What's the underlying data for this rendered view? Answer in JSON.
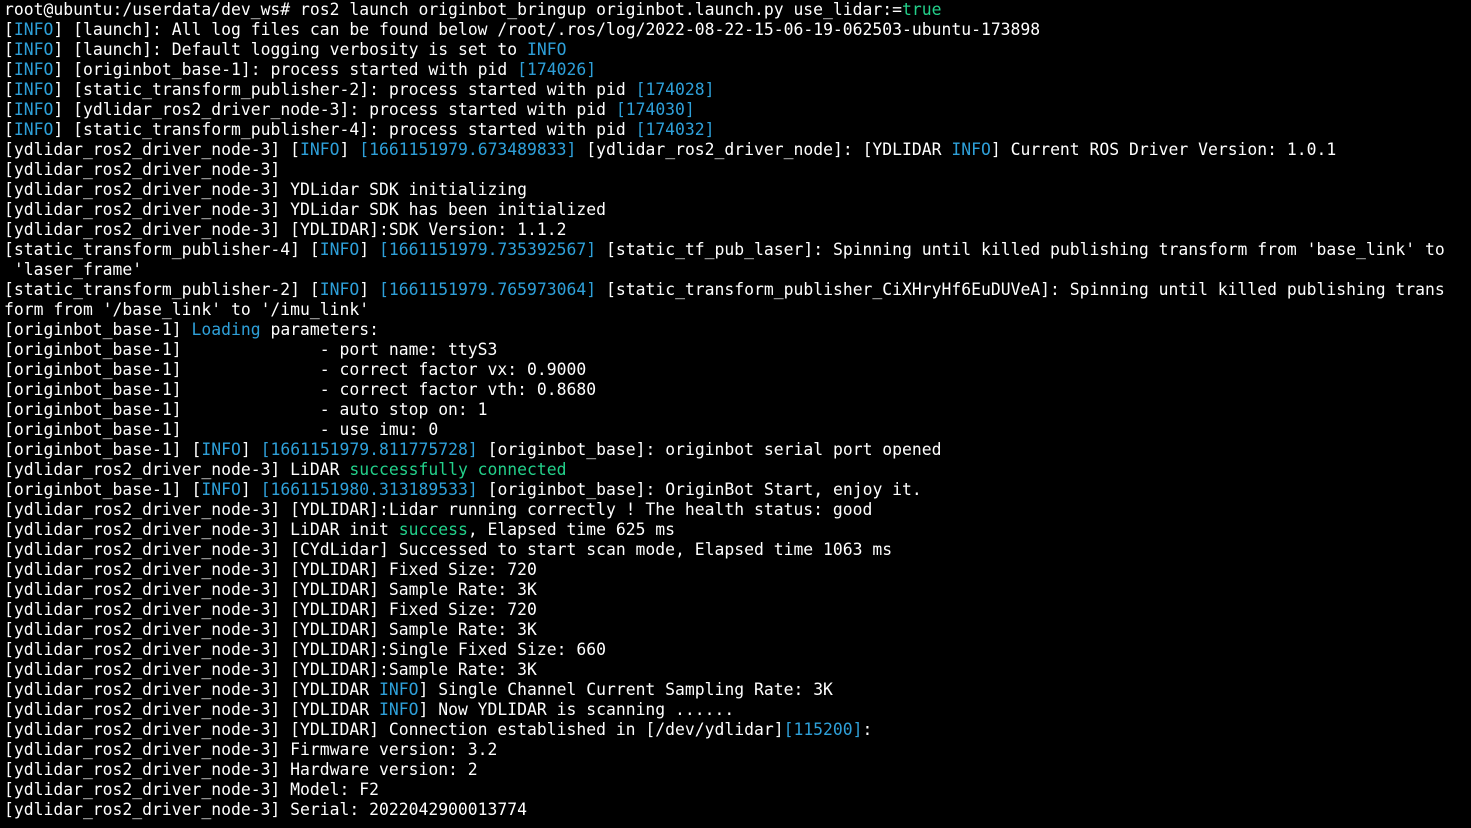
{
  "colors": {
    "background": "#000000",
    "text": "#ffffff",
    "info": "#2ea0d9",
    "green": "#23d18b"
  },
  "terminal": {
    "lines": [
      [
        {
          "t": "root@ubuntu:/userdata/dev_ws# ros2 launch originbot_bringup originbot.launch.py use_lidar:=",
          "c": "default"
        },
        {
          "t": "true",
          "c": "green"
        }
      ],
      [
        {
          "t": "[",
          "c": "default"
        },
        {
          "t": "INFO",
          "c": "info"
        },
        {
          "t": "] [launch]: All log files can be found below /root/.ros/log/2022-08-22-15-06-19-062503-ubuntu-173898",
          "c": "default"
        }
      ],
      [
        {
          "t": "[",
          "c": "default"
        },
        {
          "t": "INFO",
          "c": "info"
        },
        {
          "t": "] [launch]: Default logging verbosity is set to ",
          "c": "default"
        },
        {
          "t": "INFO",
          "c": "info"
        }
      ],
      [
        {
          "t": "[",
          "c": "default"
        },
        {
          "t": "INFO",
          "c": "info"
        },
        {
          "t": "] [originbot_base-1]: process started with pid ",
          "c": "default"
        },
        {
          "t": "[174026]",
          "c": "num"
        }
      ],
      [
        {
          "t": "[",
          "c": "default"
        },
        {
          "t": "INFO",
          "c": "info"
        },
        {
          "t": "] [static_transform_publisher-2]: process started with pid ",
          "c": "default"
        },
        {
          "t": "[174028]",
          "c": "num"
        }
      ],
      [
        {
          "t": "[",
          "c": "default"
        },
        {
          "t": "INFO",
          "c": "info"
        },
        {
          "t": "] [ydlidar_ros2_driver_node-3]: process started with pid ",
          "c": "default"
        },
        {
          "t": "[174030]",
          "c": "num"
        }
      ],
      [
        {
          "t": "[",
          "c": "default"
        },
        {
          "t": "INFO",
          "c": "info"
        },
        {
          "t": "] [static_transform_publisher-4]: process started with pid ",
          "c": "default"
        },
        {
          "t": "[174032]",
          "c": "num"
        }
      ],
      [
        {
          "t": "[ydlidar_ros2_driver_node-3] [",
          "c": "default"
        },
        {
          "t": "INFO",
          "c": "info"
        },
        {
          "t": "] ",
          "c": "default"
        },
        {
          "t": "[1661151979.673489833]",
          "c": "num"
        },
        {
          "t": " [ydlidar_ros2_driver_node]: [YDLIDAR ",
          "c": "default"
        },
        {
          "t": "INFO",
          "c": "info"
        },
        {
          "t": "] Current ROS Driver Version: 1.0.1",
          "c": "default"
        }
      ],
      [
        {
          "t": "[ydlidar_ros2_driver_node-3]",
          "c": "default"
        }
      ],
      [
        {
          "t": "[ydlidar_ros2_driver_node-3] YDLidar SDK initializing",
          "c": "default"
        }
      ],
      [
        {
          "t": "[ydlidar_ros2_driver_node-3] YDLidar SDK has been initialized",
          "c": "default"
        }
      ],
      [
        {
          "t": "[ydlidar_ros2_driver_node-3] [YDLIDAR]:SDK Version: 1.1.2",
          "c": "default"
        }
      ],
      [
        {
          "t": "[static_transform_publisher-4] [",
          "c": "default"
        },
        {
          "t": "INFO",
          "c": "info"
        },
        {
          "t": "] ",
          "c": "default"
        },
        {
          "t": "[1661151979.735392567]",
          "c": "num"
        },
        {
          "t": " [static_tf_pub_laser]: Spinning until killed publishing transform from 'base_link' to",
          "c": "default"
        }
      ],
      [
        {
          "t": " 'laser_frame'",
          "c": "default"
        }
      ],
      [
        {
          "t": "[static_transform_publisher-2] [",
          "c": "default"
        },
        {
          "t": "INFO",
          "c": "info"
        },
        {
          "t": "] ",
          "c": "default"
        },
        {
          "t": "[1661151979.765973064]",
          "c": "num"
        },
        {
          "t": " [static_transform_publisher_CiXHryHf6EuDUVeA]: Spinning until killed publishing trans",
          "c": "default"
        }
      ],
      [
        {
          "t": "form from '/base_link' to '/imu_link'",
          "c": "default"
        }
      ],
      [
        {
          "t": "[originbot_base-1] ",
          "c": "default"
        },
        {
          "t": "Loading",
          "c": "blue"
        },
        {
          "t": " parameters:",
          "c": "default"
        }
      ],
      [
        {
          "t": "[originbot_base-1]              - port name: ttyS3",
          "c": "default"
        }
      ],
      [
        {
          "t": "[originbot_base-1]              - correct factor vx: 0.9000",
          "c": "default"
        }
      ],
      [
        {
          "t": "[originbot_base-1]              - correct factor vth: 0.8680",
          "c": "default"
        }
      ],
      [
        {
          "t": "[originbot_base-1]              - auto stop on: 1",
          "c": "default"
        }
      ],
      [
        {
          "t": "[originbot_base-1]              - use imu: 0",
          "c": "default"
        }
      ],
      [
        {
          "t": "[originbot_base-1] [",
          "c": "default"
        },
        {
          "t": "INFO",
          "c": "info"
        },
        {
          "t": "] ",
          "c": "default"
        },
        {
          "t": "[1661151979.811775728]",
          "c": "num"
        },
        {
          "t": " [originbot_base]: originbot serial port opened",
          "c": "default"
        }
      ],
      [
        {
          "t": "[ydlidar_ros2_driver_node-3] LiDAR ",
          "c": "default"
        },
        {
          "t": "successfully connected",
          "c": "green"
        }
      ],
      [
        {
          "t": "[originbot_base-1] [",
          "c": "default"
        },
        {
          "t": "INFO",
          "c": "info"
        },
        {
          "t": "] ",
          "c": "default"
        },
        {
          "t": "[1661151980.313189533]",
          "c": "num"
        },
        {
          "t": " [originbot_base]: OriginBot Start, enjoy it.",
          "c": "default"
        }
      ],
      [
        {
          "t": "[ydlidar_ros2_driver_node-3] [YDLIDAR]:Lidar running correctly ! The health status: good",
          "c": "default"
        }
      ],
      [
        {
          "t": "[ydlidar_ros2_driver_node-3] LiDAR init ",
          "c": "default"
        },
        {
          "t": "success",
          "c": "green"
        },
        {
          "t": ", Elapsed time 625 ms",
          "c": "default"
        }
      ],
      [
        {
          "t": "[ydlidar_ros2_driver_node-3] [CYdLidar] Successed to start scan mode, Elapsed time 1063 ms",
          "c": "default"
        }
      ],
      [
        {
          "t": "[ydlidar_ros2_driver_node-3] [YDLIDAR] Fixed Size: 720",
          "c": "default"
        }
      ],
      [
        {
          "t": "[ydlidar_ros2_driver_node-3] [YDLIDAR] Sample Rate: 3K",
          "c": "default"
        }
      ],
      [
        {
          "t": "[ydlidar_ros2_driver_node-3] [YDLIDAR] Fixed Size: 720",
          "c": "default"
        }
      ],
      [
        {
          "t": "[ydlidar_ros2_driver_node-3] [YDLIDAR] Sample Rate: 3K",
          "c": "default"
        }
      ],
      [
        {
          "t": "[ydlidar_ros2_driver_node-3] [YDLIDAR]:Single Fixed Size: 660",
          "c": "default"
        }
      ],
      [
        {
          "t": "[ydlidar_ros2_driver_node-3] [YDLIDAR]:Sample Rate: 3K",
          "c": "default"
        }
      ],
      [
        {
          "t": "[ydlidar_ros2_driver_node-3] [YDLIDAR ",
          "c": "default"
        },
        {
          "t": "INFO",
          "c": "info"
        },
        {
          "t": "] Single Channel Current Sampling Rate: 3K",
          "c": "default"
        }
      ],
      [
        {
          "t": "[ydlidar_ros2_driver_node-3] [YDLIDAR ",
          "c": "default"
        },
        {
          "t": "INFO",
          "c": "info"
        },
        {
          "t": "] Now YDLIDAR is scanning ......",
          "c": "default"
        }
      ],
      [
        {
          "t": "[ydlidar_ros2_driver_node-3] [YDLIDAR] Connection established in [/dev/ydlidar]",
          "c": "default"
        },
        {
          "t": "[115200]",
          "c": "num"
        },
        {
          "t": ":",
          "c": "default"
        }
      ],
      [
        {
          "t": "[ydlidar_ros2_driver_node-3] Firmware version: 3.2",
          "c": "default"
        }
      ],
      [
        {
          "t": "[ydlidar_ros2_driver_node-3] Hardware version: 2",
          "c": "default"
        }
      ],
      [
        {
          "t": "[ydlidar_ros2_driver_node-3] Model: F2",
          "c": "default"
        }
      ],
      [
        {
          "t": "[ydlidar_ros2_driver_node-3] Serial: 2022042900013774",
          "c": "default"
        }
      ]
    ]
  }
}
